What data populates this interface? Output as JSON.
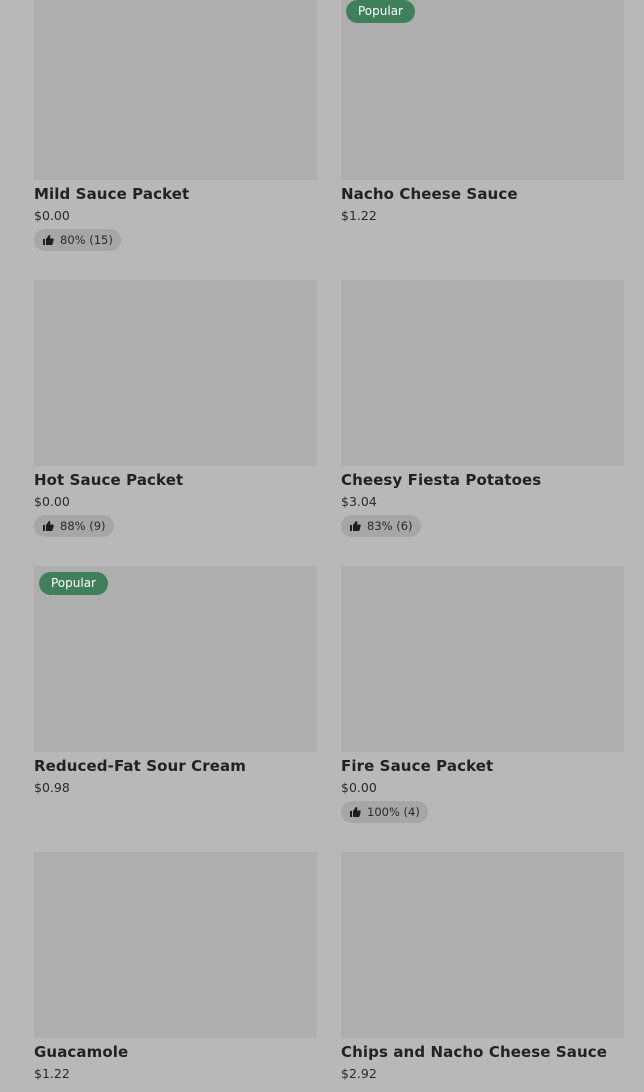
{
  "items": [
    {
      "name": "Mild Sauce Packet",
      "price": "$0.00",
      "rating": "80% (15)",
      "badge": ""
    },
    {
      "name": "Nacho Cheese Sauce",
      "price": "$1.22",
      "rating": "",
      "badge": "Popular"
    },
    {
      "name": "Hot Sauce Packet",
      "price": "$0.00",
      "rating": "88% (9)",
      "badge": ""
    },
    {
      "name": "Cheesy Fiesta Potatoes",
      "price": "$3.04",
      "rating": "83% (6)",
      "badge": ""
    },
    {
      "name": "Reduced-Fat Sour Cream",
      "price": "$0.98",
      "rating": "",
      "badge": "Popular"
    },
    {
      "name": "Fire Sauce Packet",
      "price": "$0.00",
      "rating": "100% (4)",
      "badge": ""
    },
    {
      "name": "Guacamole",
      "price": "$1.22",
      "rating": "",
      "badge": ""
    },
    {
      "name": "Chips and Nacho Cheese Sauce",
      "price": "$2.92",
      "rating": "",
      "badge": ""
    }
  ]
}
